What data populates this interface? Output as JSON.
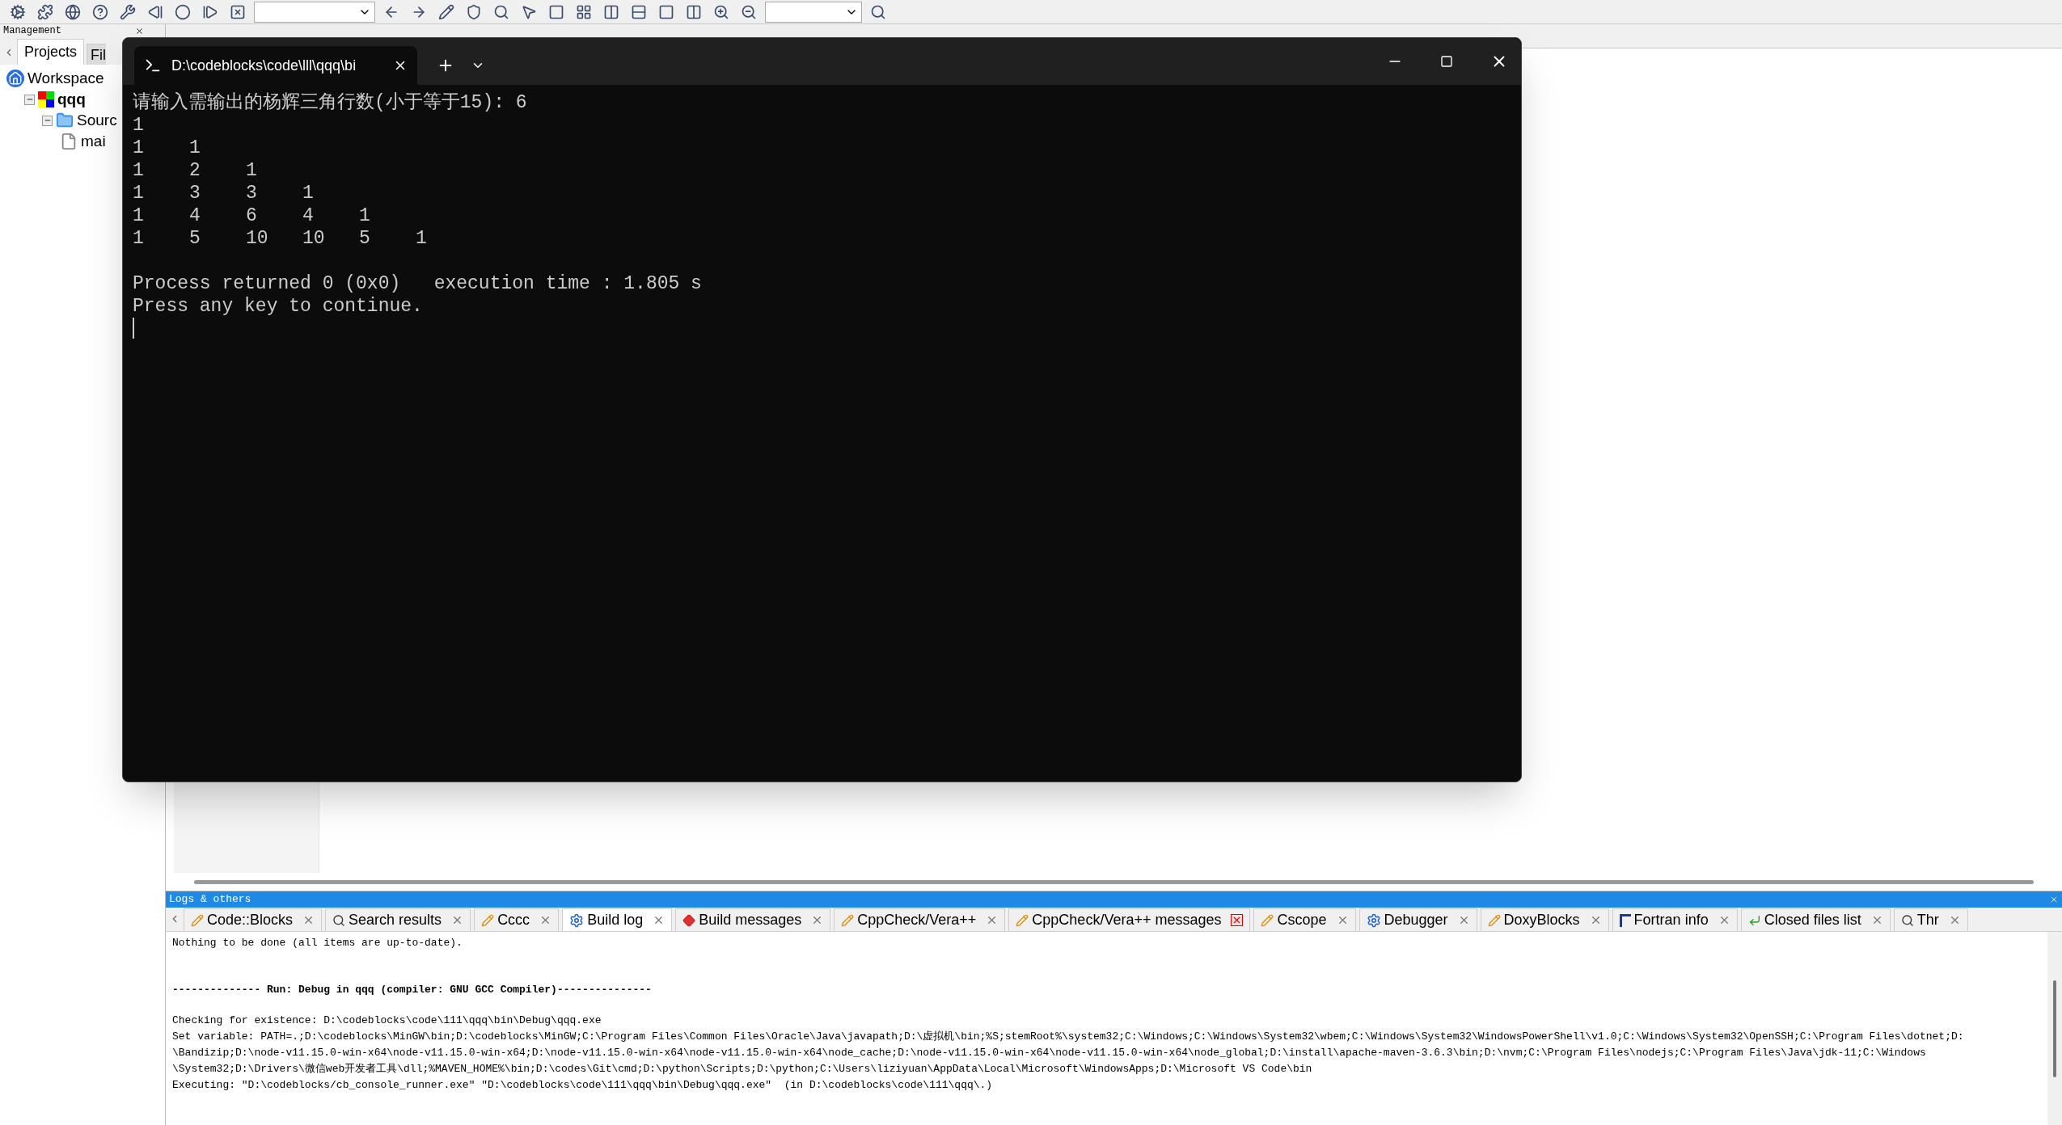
{
  "management": {
    "title": "Management",
    "tabs": [
      {
        "label": "Projects",
        "selected": true
      },
      {
        "label": "Fil",
        "selected": false
      }
    ],
    "tree": [
      {
        "label": "Workspace",
        "kind": "workspace",
        "children": [
          {
            "label": "qqq",
            "kind": "project",
            "expanded": true,
            "children": [
              {
                "label": "Sourc",
                "kind": "folder",
                "expanded": true,
                "children": [
                  {
                    "label": "mai",
                    "kind": "file"
                  }
                ]
              }
            ]
          }
        ]
      }
    ]
  },
  "terminal": {
    "tab_title": "D:\\codeblocks\\code\\lll\\qqq\\bi",
    "prompt": "请输入需输出的杨辉三角行数(小于等于15): 6",
    "rows": [
      [
        "1"
      ],
      [
        "1",
        "1"
      ],
      [
        "1",
        "2",
        "1"
      ],
      [
        "1",
        "3",
        "3",
        "1"
      ],
      [
        "1",
        "4",
        "6",
        "4",
        "1"
      ],
      [
        "1",
        "5",
        "10",
        "10",
        "5",
        "1"
      ]
    ],
    "lines": [
      "Process returned 0 (0x0)   execution time : 1.805 s",
      "Press any key to continue."
    ]
  },
  "logs": {
    "title": "Logs & others",
    "tabs": [
      {
        "label": "Code::Blocks",
        "kind": "note",
        "selected": false,
        "close_highlighted": false
      },
      {
        "label": "Search results",
        "kind": "search",
        "selected": false,
        "close_highlighted": false
      },
      {
        "label": "Cccc",
        "kind": "note",
        "selected": false,
        "close_highlighted": false
      },
      {
        "label": "Build log",
        "kind": "gear",
        "selected": true,
        "close_highlighted": false
      },
      {
        "label": "Build messages",
        "kind": "flag",
        "selected": false,
        "close_highlighted": false
      },
      {
        "label": "CppCheck/Vera++",
        "kind": "note",
        "selected": false,
        "close_highlighted": false
      },
      {
        "label": "CppCheck/Vera++ messages",
        "kind": "note",
        "selected": false,
        "close_highlighted": true
      },
      {
        "label": "Cscope",
        "kind": "note",
        "selected": false,
        "close_highlighted": false
      },
      {
        "label": "Debugger",
        "kind": "gear",
        "selected": false,
        "close_highlighted": false
      },
      {
        "label": "DoxyBlocks",
        "kind": "note",
        "selected": false,
        "close_highlighted": false
      },
      {
        "label": "Fortran info",
        "kind": "fortran",
        "selected": false,
        "close_highlighted": false
      },
      {
        "label": "Closed files list",
        "kind": "back",
        "selected": false,
        "close_highlighted": false
      },
      {
        "label": "Thr",
        "kind": "search",
        "selected": false,
        "close_highlighted": false
      }
    ],
    "lines": [
      {
        "kind": "plain",
        "text": "Nothing to be done (all items are up-to-date)."
      },
      {
        "kind": "heading",
        "text": "-------------- Run: Debug in qqq (compiler: GNU GCC Compiler)---------------"
      },
      {
        "kind": "plain",
        "text": "Checking for existence: D:\\codeblocks\\code\\111\\qqq\\bin\\Debug\\qqq.exe"
      },
      {
        "kind": "plain",
        "text": "Set variable: PATH=.;D:\\codeblocks\\MinGW\\bin;D:\\codeblocks\\MinGW;C:\\Program Files\\Common Files\\Oracle\\Java\\javapath;D:\\虚拟机\\bin;%S;stemRoot%\\system32;C:\\Windows;C:\\Windows\\System32\\wbem;C:\\Windows\\System32\\WindowsPowerShell\\v1.0;C:\\Windows\\System32\\OpenSSH;C:\\Program Files\\dotnet;D:"
      },
      {
        "kind": "plain",
        "text": "\\Bandizip;D:\\node-v11.15.0-win-x64\\node-v11.15.0-win-x64;D:\\node-v11.15.0-win-x64\\node-v11.15.0-win-x64\\node_cache;D:\\node-v11.15.0-win-x64\\node-v11.15.0-win-x64\\node_global;D:\\install\\apache-maven-3.6.3\\bin;D:\\nvm;C:\\Program Files\\nodejs;C:\\Program Files\\Java\\jdk-11;C:\\Windows"
      },
      {
        "kind": "plain",
        "text": "\\System32;D:\\Drivers\\微信web开发者工具\\dll;%MAVEN_HOME%\\bin;D:\\codes\\Git\\cmd;D:\\python\\Scripts;D:\\python;C:\\Users\\liziyuan\\AppData\\Local\\Microsoft\\WindowsApps;D:\\Microsoft VS Code\\bin"
      },
      {
        "kind": "plain",
        "text": "Executing: \"D:\\codeblocks/cb_console_runner.exe\" \"D:\\codeblocks\\code\\111\\qqq\\bin\\Debug\\qqq.exe\"  (in D:\\codeblocks\\code\\111\\qqq\\.)"
      }
    ]
  }
}
